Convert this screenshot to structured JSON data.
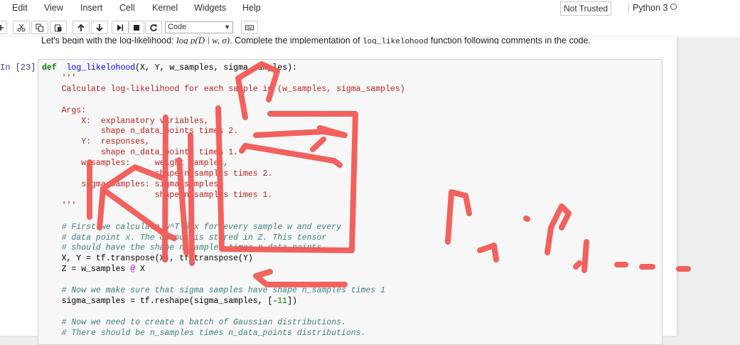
{
  "menu": [
    "Edit",
    "View",
    "Insert",
    "Cell",
    "Kernel",
    "Widgets",
    "Help"
  ],
  "trust_label": "Not Trusted",
  "kernel_name": "Python 3",
  "toolbar": {
    "cell_type": "Code",
    "icons": [
      "add-icon",
      "cut-icon",
      "copy-icon",
      "paste-icon",
      "move-up-icon",
      "move-down-icon",
      "run-icon",
      "stop-icon",
      "restart-icon",
      "keyboard-icon"
    ]
  },
  "markdown": {
    "before": "Let's begin with the log-likelihood: ",
    "math": "log p(D | w, σ)",
    "middle": ". Complete the implementation of ",
    "code": "log_likelohood",
    "after": " function following comments in the code."
  },
  "prompt": "In [23]:",
  "code": [
    {
      "parts": [
        [
          "kw",
          "def"
        ],
        [
          "",
          "  "
        ],
        [
          "fn",
          "log_likelohood"
        ],
        [
          "",
          "(X, Y, w_samples, sigma_samples):"
        ]
      ]
    },
    {
      "parts": [
        [
          "st",
          "    '''"
        ]
      ]
    },
    {
      "parts": [
        [
          "st",
          "    Calculate log-likelihood for each sample in (w_samples, sigma_samples)"
        ]
      ]
    },
    {
      "parts": [
        [
          "",
          ""
        ]
      ]
    },
    {
      "parts": [
        [
          "st",
          "    Args:"
        ]
      ]
    },
    {
      "parts": [
        [
          "st",
          "        X:  explanatory variables,"
        ]
      ]
    },
    {
      "parts": [
        [
          "st",
          "            shape n_data_points times 2."
        ]
      ]
    },
    {
      "parts": [
        [
          "st",
          "        Y:  responses,"
        ]
      ]
    },
    {
      "parts": [
        [
          "st",
          "            shape n_data_points times 1."
        ]
      ]
    },
    {
      "parts": [
        [
          "st",
          "        w_samples:     weight samples,"
        ]
      ]
    },
    {
      "parts": [
        [
          "st",
          "                       shape n_samples times 2."
        ]
      ]
    },
    {
      "parts": [
        [
          "st",
          "        sigma_samples: sigma samples,"
        ]
      ]
    },
    {
      "parts": [
        [
          "st",
          "                       shape n_samples times 1."
        ]
      ]
    },
    {
      "parts": [
        [
          "st",
          "    '''"
        ]
      ]
    },
    {
      "parts": [
        [
          "",
          ""
        ]
      ]
    },
    {
      "parts": [
        [
          "cm",
          "    # First we calculate w^T @ x for every sample w and every"
        ]
      ]
    },
    {
      "parts": [
        [
          "cm",
          "    # data point x. The output is stored in Z. This tensor"
        ]
      ]
    },
    {
      "parts": [
        [
          "cm",
          "    # should have the shape n_samples times n_data_points."
        ]
      ]
    },
    {
      "parts": [
        [
          "",
          "    X, Y = tf.transpose(X), tf.transpose(Y)"
        ]
      ]
    },
    {
      "parts": [
        [
          "",
          "    Z = w_samples "
        ],
        [
          "op",
          "@"
        ],
        [
          "",
          " X"
        ]
      ]
    },
    {
      "parts": [
        [
          "",
          ""
        ]
      ]
    },
    {
      "parts": [
        [
          "cm",
          "    # Now we make sure that sigma samples have shape n_samples times 1"
        ]
      ]
    },
    {
      "parts": [
        [
          "",
          "    sigma_samples = tf.reshape(sigma_samples, [-"
        ],
        [
          "nm",
          "1"
        ],
        [
          ", "
        ],
        [
          "nm",
          "1"
        ],
        [
          "",
          "])"
        ]
      ]
    },
    {
      "parts": [
        [
          "",
          ""
        ]
      ]
    },
    {
      "parts": [
        [
          "cm",
          "    # Now we need to create a batch of Gaussian distributions."
        ]
      ]
    },
    {
      "parts": [
        [
          "cm",
          "    # There should be n_samples times n_data_points distributions."
        ]
      ]
    }
  ],
  "colors": {
    "annotation": "#f25a55",
    "prompt": "#303f9f"
  }
}
